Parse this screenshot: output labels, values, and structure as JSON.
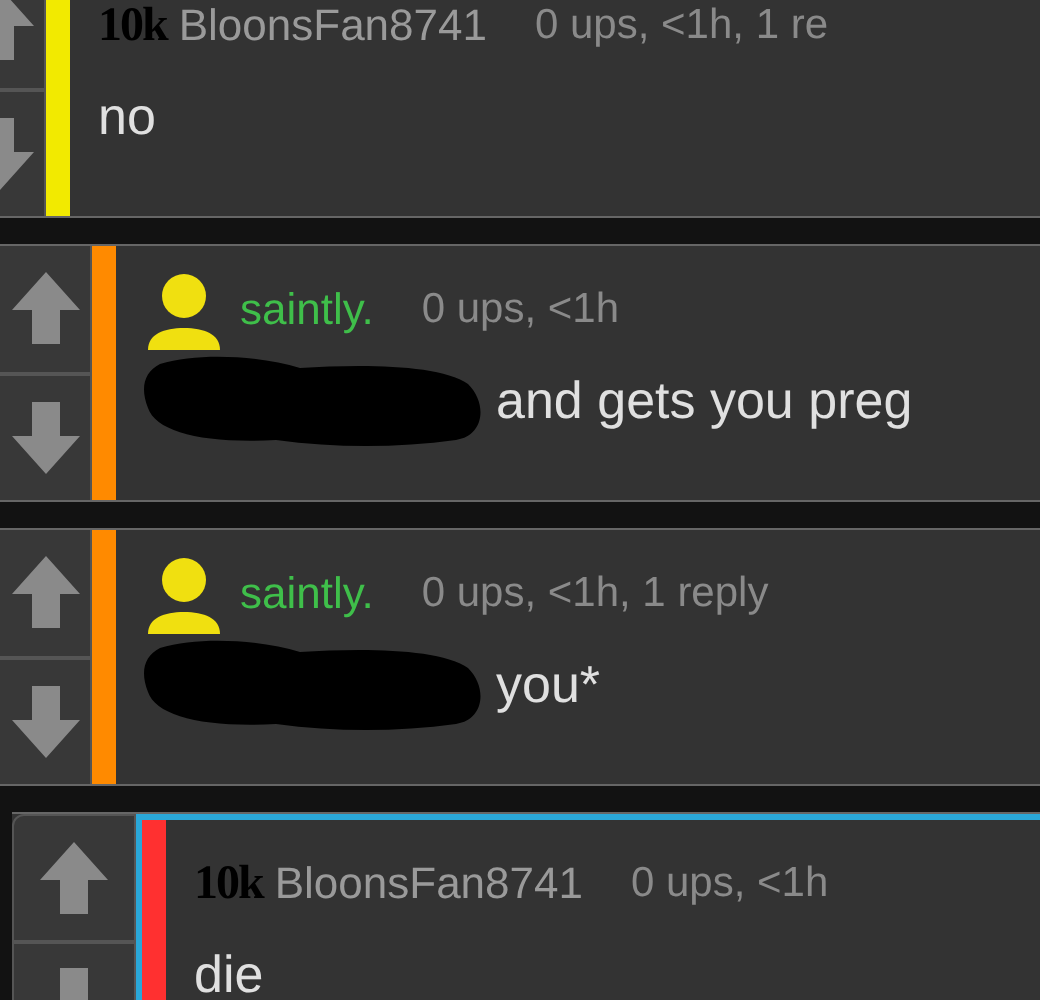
{
  "comments": [
    {
      "avatar": {
        "kind": "badge",
        "text": "10k"
      },
      "username": "BloonsFan8741",
      "op": false,
      "meta": "0 ups, <1h, 1 re",
      "color": "#f2ea00",
      "highlighted": false,
      "body": [
        {
          "kind": "text",
          "text": "no"
        }
      ],
      "children": [
        {
          "avatar": {
            "kind": "person"
          },
          "username": "saintly.",
          "op": true,
          "meta": "0 ups, <1h",
          "color": "#ff8a00",
          "highlighted": false,
          "body": [
            {
              "kind": "redaction"
            },
            {
              "kind": "text",
              "text": "and gets you preg"
            }
          ]
        },
        {
          "avatar": {
            "kind": "person"
          },
          "username": "saintly.",
          "op": true,
          "meta": "0 ups, <1h, 1 reply",
          "color": "#ff8a00",
          "highlighted": false,
          "body": [
            {
              "kind": "redaction"
            },
            {
              "kind": "text",
              "text": "you*"
            }
          ],
          "children": [
            {
              "avatar": {
                "kind": "badge",
                "text": "10k"
              },
              "username": "BloonsFan8741",
              "op": false,
              "meta": "0 ups, <1h",
              "color": "#ff3030",
              "highlighted": true,
              "body": [
                {
                  "kind": "text",
                  "text": "die"
                }
              ]
            }
          ]
        }
      ]
    }
  ]
}
